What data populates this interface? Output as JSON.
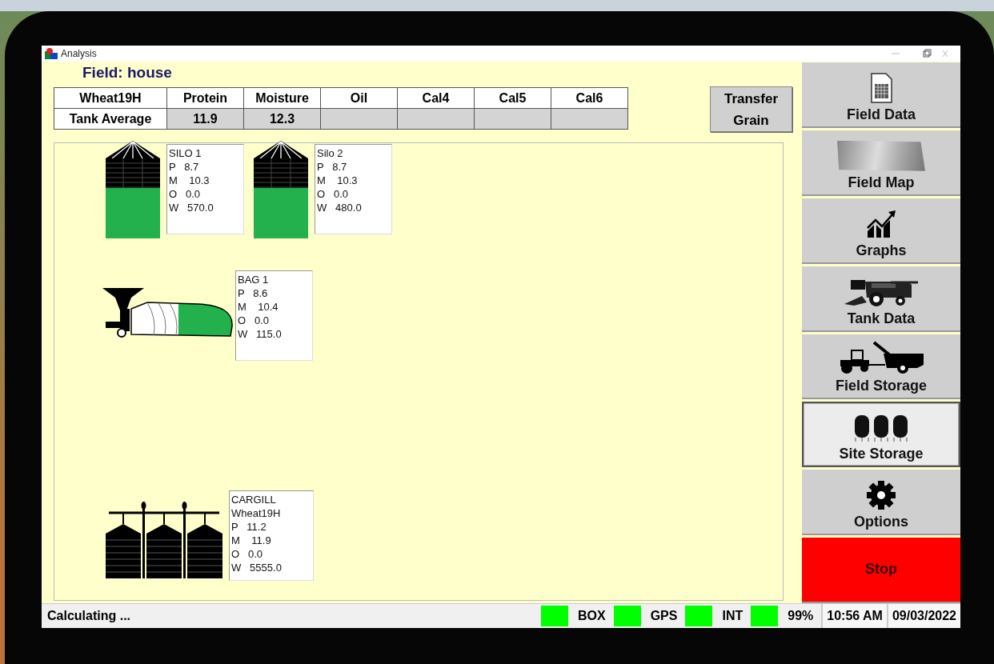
{
  "window": {
    "title": "Analysis"
  },
  "field_title": "Field: house",
  "table": {
    "columns": [
      "Wheat19H",
      "Protein",
      "Moisture",
      "Oil",
      "Cal4",
      "Cal5",
      "Cal6"
    ],
    "rows": [
      {
        "label": "Tank Average",
        "values": [
          "11.9",
          "12.3"
        ]
      }
    ]
  },
  "transfer_button": "Transfer Grain",
  "storage_rows": [
    [
      {
        "kind": "silo",
        "level": 0.63,
        "name": "SILO 1",
        "readings": [
          "P   8.7",
          "M    10.3",
          "O   0.0",
          "W   570.0"
        ]
      },
      {
        "kind": "silo",
        "level": 0.63,
        "name": "Silo 2",
        "readings": [
          "P   8.7",
          "M    10.3",
          "O   0.0",
          "W   480.0"
        ]
      }
    ],
    [
      {
        "kind": "bag",
        "level": 0.55,
        "name": "BAG 1",
        "readings": [
          "P   8.6",
          "M    10.4",
          "O   0.0",
          "W   115.0"
        ]
      }
    ],
    [
      {
        "kind": "site",
        "name": "CARGILL",
        "subtitle": "Wheat19H",
        "readings": [
          "P   11.2",
          "M    11.9",
          "O   0.0",
          "W   5555.0"
        ]
      }
    ]
  ],
  "sidebar": {
    "items": [
      {
        "label": "Field Data",
        "kind": "nav",
        "selected": false
      },
      {
        "label": "Field Map",
        "kind": "nav",
        "selected": false
      },
      {
        "label": "Graphs",
        "kind": "nav",
        "selected": false
      },
      {
        "label": "Tank Data",
        "kind": "nav",
        "selected": false
      },
      {
        "label": "Field Storage",
        "kind": "nav",
        "selected": false
      },
      {
        "label": "Site Storage",
        "kind": "nav",
        "selected": true
      },
      {
        "label": "Options",
        "kind": "nav",
        "selected": false
      },
      {
        "label": "Stop",
        "kind": "stop",
        "selected": false
      }
    ]
  },
  "status_bar": {
    "message": "Calculating ...",
    "indicators": [
      {
        "label": "BOX",
        "on": true
      },
      {
        "label": "GPS",
        "on": true
      },
      {
        "label": "INT",
        "on": true
      },
      {
        "label": "99%",
        "on": true
      }
    ],
    "time": "10:56 AM",
    "date": "09/03/2022"
  }
}
